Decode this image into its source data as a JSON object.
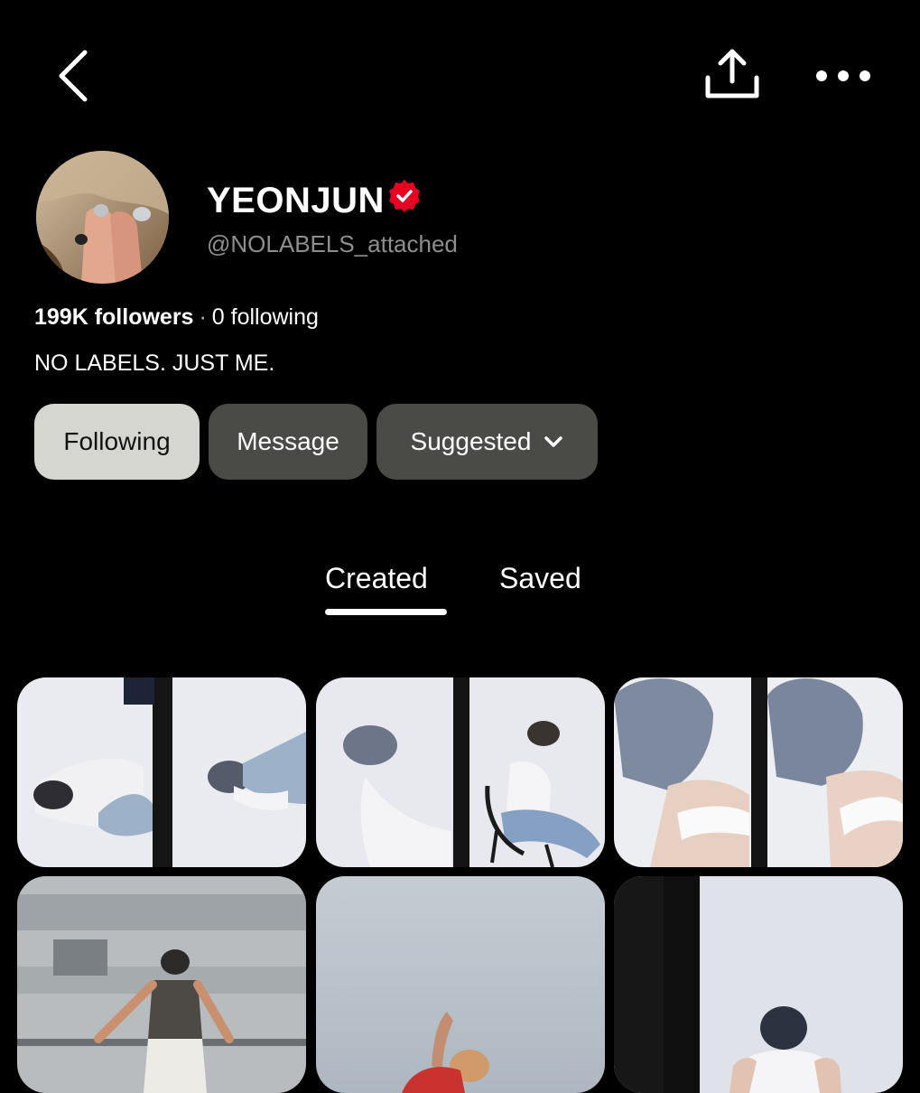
{
  "top_bar": {
    "back_icon": "chevron-left-icon",
    "share_icon": "share-upload-icon",
    "more_icon": "more-horizontal-icon"
  },
  "profile": {
    "display_name": "YEONJUN",
    "verified_icon": "verified-badge-icon",
    "verified_color": "#e60023",
    "username": "@NOLABELS_attached",
    "followers": "199K followers",
    "separator": "·",
    "following": "0 following",
    "bio": "NO LABELS. JUST ME."
  },
  "actions": {
    "following_label": "Following",
    "message_label": "Message",
    "suggested_label": "Suggested",
    "suggested_icon": "chevron-down-icon"
  },
  "tabs": [
    {
      "label": "Created",
      "active": true
    },
    {
      "label": "Saved",
      "active": false
    }
  ],
  "pins": [
    {
      "description": "film strip photo"
    },
    {
      "description": "film strip photo"
    },
    {
      "description": "film strip photo"
    },
    {
      "description": "photo"
    },
    {
      "description": "photo"
    },
    {
      "description": "photo"
    }
  ]
}
